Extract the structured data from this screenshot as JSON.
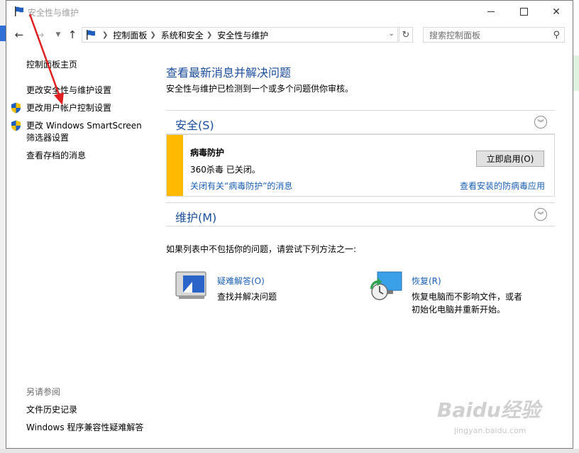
{
  "window": {
    "title": "安全性与维护",
    "help_label": "?"
  },
  "nav": {
    "breadcrumb": [
      "控制面板",
      "系统和安全",
      "安全性与维护"
    ],
    "search_placeholder": "搜索控制面板"
  },
  "sidebar": {
    "home": "控制面板主页",
    "links": [
      {
        "label": "更改安全性与维护设置",
        "shield": false
      },
      {
        "label": "更改用户帐户控制设置",
        "shield": true
      },
      {
        "label_line1": "更改 Windows SmartScreen",
        "label_line2": "筛选器设置",
        "shield": true
      },
      {
        "label": "查看存档的消息",
        "shield": false
      }
    ],
    "see_also_header": "另请参阅",
    "see_also": [
      "文件历史记录",
      "Windows 程序兼容性疑难解答"
    ]
  },
  "main": {
    "title": "查看最新消息并解决问题",
    "description": "安全性与维护已检测到一个或多个问题供你审核。",
    "security_section": {
      "title": "安全(S)",
      "alert": {
        "title": "病毒防护",
        "status": "360杀毒 已关闭。",
        "button": "立即启用(O)",
        "link_turn_off": "关闭有关“病毒防护”的消息",
        "link_view_installed": "查看安装的防病毒应用",
        "accent_color": "#ffba00"
      }
    },
    "maintenance_section": {
      "title": "维护(M)"
    },
    "try_text": "如果列表中不包括你的问题，请尝试下列方法之一:",
    "tools": [
      {
        "name": "疑难解答(O)",
        "desc_lines": [
          "查找并解决问题"
        ]
      },
      {
        "name": "恢复(R)",
        "desc_lines": [
          "恢复电脑而不影响文件，或者",
          "初始化电脑并重新开始。"
        ]
      }
    ]
  },
  "watermark": {
    "logo": "Baidu经验",
    "sub": "jingyan.baidu.com"
  },
  "colors": {
    "link": "#1a5fb4",
    "heading": "#1a4d9c",
    "annotation_arrow": "#e02020"
  }
}
